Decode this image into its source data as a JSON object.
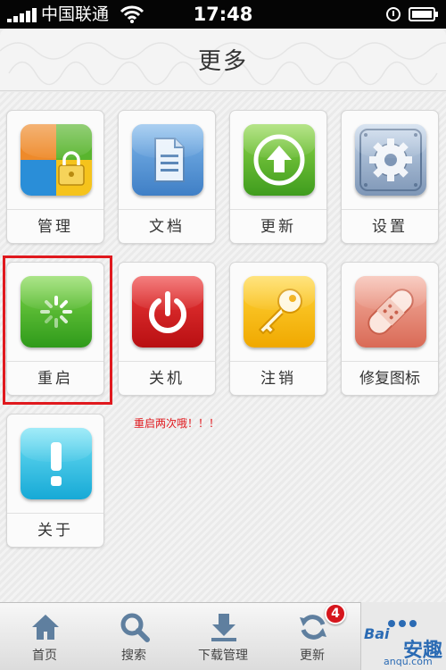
{
  "status_bar": {
    "carrier": "中国联通",
    "time": "17:48"
  },
  "header": {
    "title": "更多"
  },
  "grid": {
    "tiles": [
      {
        "id": "manage",
        "label": "管理",
        "icon": "windows-lock-icon"
      },
      {
        "id": "docs",
        "label": "文档",
        "icon": "document-icon"
      },
      {
        "id": "update",
        "label": "更新",
        "icon": "upload-arrow-icon"
      },
      {
        "id": "settings",
        "label": "设置",
        "icon": "gear-icon"
      },
      {
        "id": "restart",
        "label": "重启",
        "icon": "loading-spinner-icon"
      },
      {
        "id": "shutdown",
        "label": "关机",
        "icon": "power-icon"
      },
      {
        "id": "logout",
        "label": "注销",
        "icon": "key-icon"
      },
      {
        "id": "repair",
        "label": "修复图标",
        "icon": "bandage-icon"
      },
      {
        "id": "about",
        "label": "关于",
        "icon": "exclamation-icon"
      }
    ]
  },
  "annotation": {
    "note": "重启两次哦！！！",
    "color": "#e0191e"
  },
  "tabbar": {
    "tabs": [
      {
        "label": "首页",
        "icon": "home-icon"
      },
      {
        "label": "搜索",
        "icon": "search-icon"
      },
      {
        "label": "下载管理",
        "icon": "download-icon"
      },
      {
        "label": "更新",
        "icon": "refresh-icon"
      }
    ],
    "update_badge": "4"
  },
  "watermark": {
    "brand": "Bai",
    "brand2": "安趣",
    "url": "anqu.com"
  },
  "colors": {
    "accent_red": "#e0191e",
    "badge_red": "#d6161d",
    "brand_blue": "#2b6bb4"
  }
}
